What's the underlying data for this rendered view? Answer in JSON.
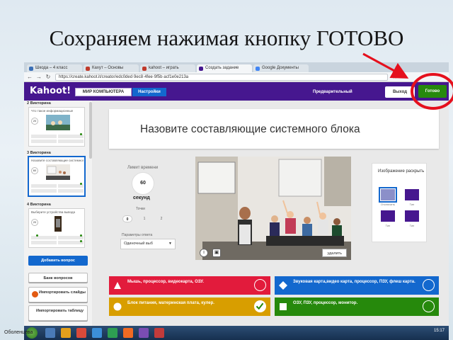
{
  "slide": {
    "title": "Сохраняем нажимая кнопку ГОТОВО",
    "credit": "Оболенцева"
  },
  "browser": {
    "tabs": [
      "Шкода – 4 класс",
      "Кахут – Основы",
      "kahoot – играть",
      "Создать задание",
      "Google Документы"
    ],
    "url": "https://create.kahoot.it/creator/edc0ded·9ec8·4fee·9f5b·acf1e0e213a"
  },
  "kahoot": {
    "logo": "Kahoot!",
    "title_field": "МИР КОМПЬЮТЕРА",
    "settings_btn": "Настройки",
    "preview_btn": "Предварительный",
    "exit_btn": "Выход",
    "done_btn": "Готово"
  },
  "sidebar": {
    "slides": [
      {
        "label": "2  Викторина",
        "title": "Что такое информационные",
        "time": "20"
      },
      {
        "label": "3  Викторина",
        "title": "Назовите составляющие системного",
        "time": "60"
      },
      {
        "label": "4  Викторина",
        "title": "Выберите устройства вывода",
        "time": "20"
      }
    ],
    "add_question": "Добавить вопрос",
    "question_bank": "Банк вопросов",
    "import_slides": "Импортировать слайды",
    "import_table": "Импортировать таблицу"
  },
  "editor": {
    "question": "Назовите составляющие системного блока",
    "time_label": "Лимит времени",
    "time_value": "60",
    "time_unit": "секунд",
    "points_label": "Точки",
    "points": [
      "0",
      "1",
      "2"
    ],
    "answer_type_label": "Параметры ответа",
    "answer_type": "Одиночный выб",
    "media_delete": "удалить",
    "reveal_title": "Изображение раскрыть",
    "reveal_options": [
      "Отключить",
      "Тип",
      "Тип",
      "Тип"
    ]
  },
  "answers": [
    {
      "text": "Мышь, процессор, видеокарта, ОЗУ.",
      "color": "#e21b3c",
      "shape": "triangle",
      "correct": false
    },
    {
      "text": "Звуковая карта,видео карта, процессор, ПЗУ, флеш карта.",
      "color": "#1368ce",
      "shape": "diamond",
      "correct": false
    },
    {
      "text": "Блок питания, материнская плата, кулер.",
      "color": "#d89e00",
      "shape": "circle",
      "correct": true
    },
    {
      "text": "ОЗУ, ПЗУ, процессор, монитор.",
      "color": "#26890c",
      "shape": "square",
      "correct": false
    }
  ],
  "taskbar": {
    "tray": "15:17"
  },
  "annotation_color": "#e5101d"
}
